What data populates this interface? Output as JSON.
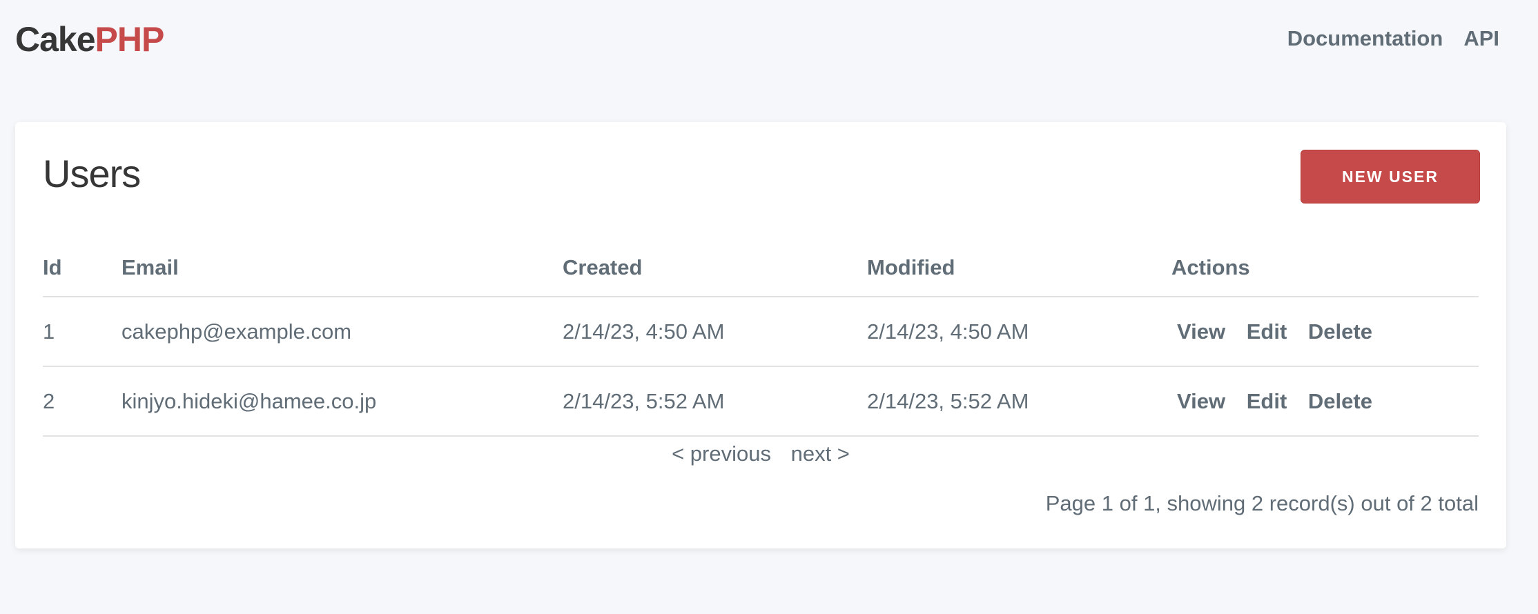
{
  "brand": {
    "part1": "Cake",
    "part2": "PHP"
  },
  "nav": {
    "documentation": "Documentation",
    "api": "API"
  },
  "page": {
    "title": "Users",
    "new_button": "NEW USER"
  },
  "table": {
    "headers": {
      "id": "Id",
      "email": "Email",
      "created": "Created",
      "modified": "Modified",
      "actions": "Actions"
    },
    "rows": [
      {
        "id": "1",
        "email": "cakephp@example.com",
        "created": "2/14/23, 4:50 AM",
        "modified": "2/14/23, 4:50 AM",
        "actions": {
          "view": "View",
          "edit": "Edit",
          "delete": "Delete"
        }
      },
      {
        "id": "2",
        "email": "kinjyo.hideki@hamee.co.jp",
        "created": "2/14/23, 5:52 AM",
        "modified": "2/14/23, 5:52 AM",
        "actions": {
          "view": "View",
          "edit": "Edit",
          "delete": "Delete"
        }
      }
    ]
  },
  "paginator": {
    "previous": "< previous",
    "next": "next >",
    "counter": "Page 1 of 1, showing 2 record(s) out of 2 total"
  },
  "colors": {
    "brand_red": "#c64a4a",
    "text_dark": "#363637",
    "text": "#606c76",
    "background": "#f5f7fa"
  }
}
